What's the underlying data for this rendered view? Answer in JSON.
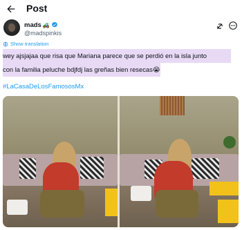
{
  "header": {
    "title": "Post"
  },
  "author": {
    "display_name": "mads",
    "name_emoji": "🚜",
    "handle": "@madspinkis"
  },
  "translation": {
    "label": "Show translation"
  },
  "tweet": {
    "line1": "wey ajsjajaa que risa que Mariana parece que se perdió en la isla junto",
    "line2": "con la familia peluche bdjfdj las greñas bien resecas😭",
    "hashtag": "#LaCasaDeLosFamososMx"
  },
  "colors": {
    "link": "#1d9bf0",
    "highlight": "#e8d9f5",
    "verified": "#1d9bf0"
  },
  "icons": {
    "back": "arrow-left-icon",
    "verified": "verified-badge-icon",
    "grok": "grok-icon",
    "more": "more-circle-icon",
    "translate": "globe-icon"
  }
}
